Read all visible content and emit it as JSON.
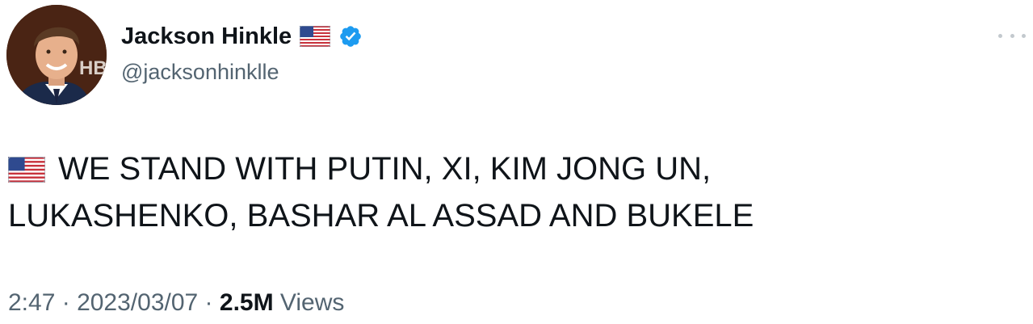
{
  "author": {
    "display_name": "Jackson Hinkle",
    "handle": "@jacksonhinklle",
    "avatar_icon": "profile-photo",
    "flag_icon": "us-flag-icon",
    "verified_icon": "verified-badge-icon",
    "verified_color": "#1d9bf0",
    "avatar_overlay_text": "HB"
  },
  "tweet": {
    "flag_icon": "us-flag-icon",
    "text_line1": "WE STAND WITH PUTIN, XI, KIM JONG UN,",
    "text_line2": "LUKASHENKO, BASHAR AL ASSAD AND BUKELE"
  },
  "meta": {
    "time": "2:47",
    "separator": " · ",
    "date": "2023/03/07",
    "separator2": " · ",
    "views_count": "2.5M",
    "views_label": " Views"
  },
  "more_icon": "more-options-icon"
}
